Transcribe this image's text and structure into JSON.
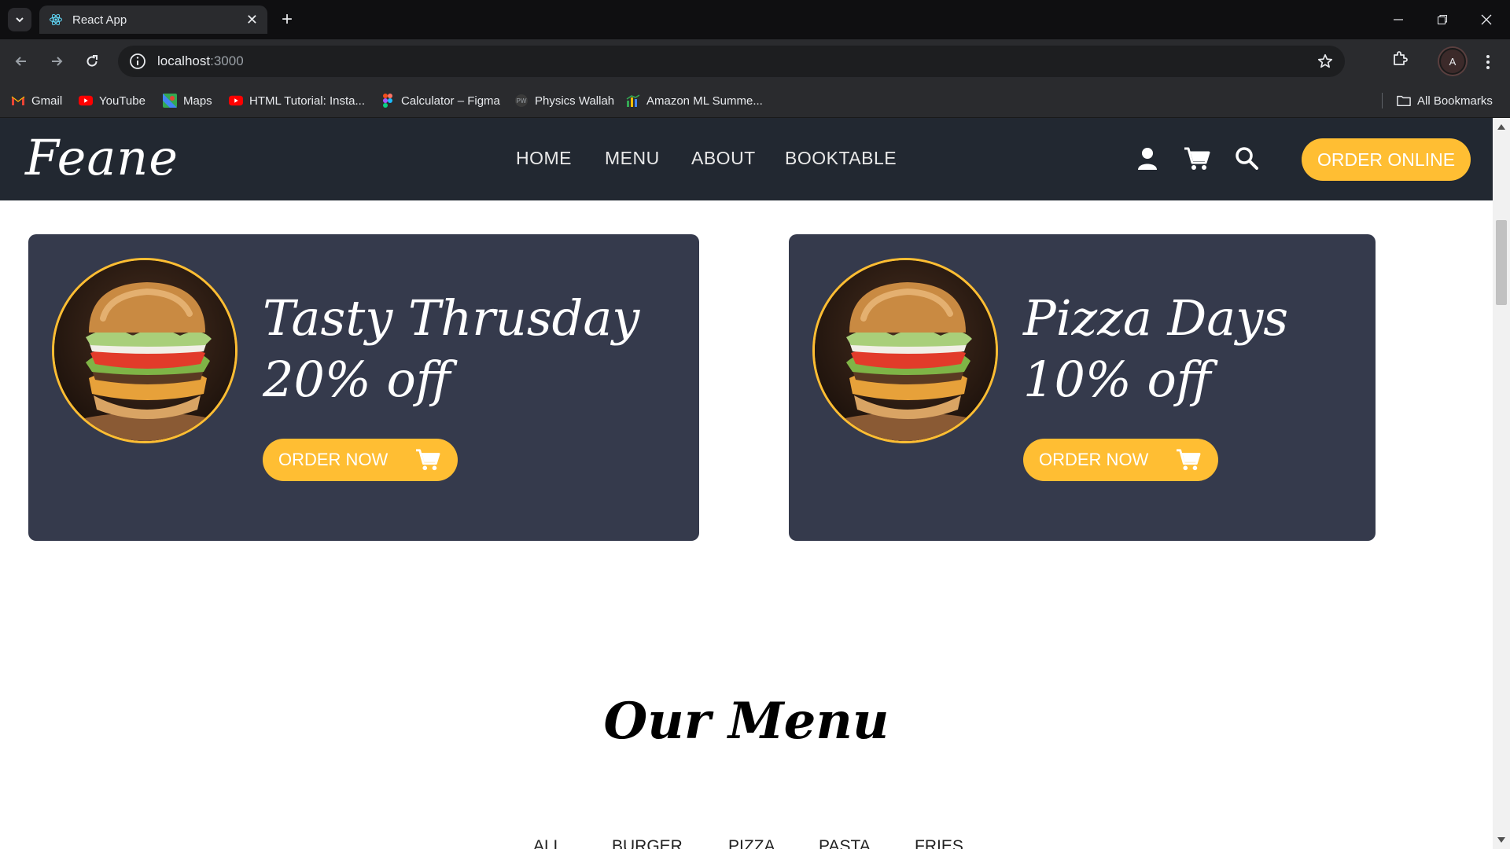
{
  "browser": {
    "tab_title": "React App",
    "url_host": "localhost",
    "url_port": ":3000",
    "profile_initial": "A",
    "bookmarks": [
      {
        "label": "Gmail",
        "icon": "gmail-icon"
      },
      {
        "label": "YouTube",
        "icon": "youtube-icon"
      },
      {
        "label": "Maps",
        "icon": "maps-icon"
      },
      {
        "label": "HTML Tutorial: Insta...",
        "icon": "youtube-icon"
      },
      {
        "label": "Calculator – Figma",
        "icon": "figma-icon"
      },
      {
        "label": "Physics Wallah",
        "icon": "pw-icon"
      },
      {
        "label": "Amazon ML Summe...",
        "icon": "chart-icon"
      }
    ],
    "all_bookmarks": "All Bookmarks"
  },
  "site": {
    "logo": "Feane",
    "nav": [
      "HOME",
      "MENU",
      "ABOUT",
      "BOOKTABLE"
    ],
    "order_online": "ORDER ONLINE",
    "accent_color": "#ffbe33",
    "header_color": "#222831",
    "card_color": "#353a4c"
  },
  "offers": [
    {
      "title": "Tasty Thrusday",
      "discount": "20% off",
      "button": "ORDER NOW"
    },
    {
      "title": "Pizza Days",
      "discount": "10% off",
      "button": "ORDER NOW"
    }
  ],
  "menu": {
    "heading": "Our Menu",
    "filters": [
      "ALL",
      "BURGER",
      "PIZZA",
      "PASTA",
      "FRIES"
    ]
  }
}
